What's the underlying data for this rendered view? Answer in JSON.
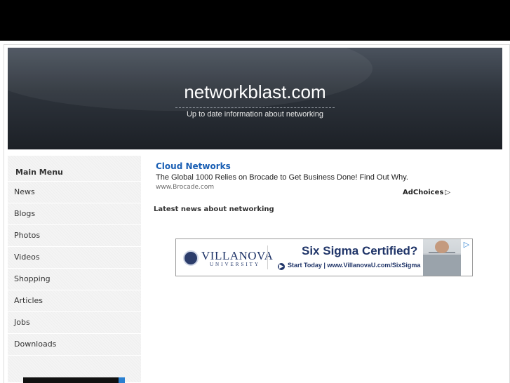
{
  "header": {
    "site_title": "networkblast.com",
    "tagline": "Up to date information about networking"
  },
  "sidebar": {
    "title": "Main Menu",
    "items": [
      {
        "label": "News"
      },
      {
        "label": "Blogs"
      },
      {
        "label": "Photos"
      },
      {
        "label": "Videos"
      },
      {
        "label": "Shopping"
      },
      {
        "label": "Articles"
      },
      {
        "label": "Jobs"
      },
      {
        "label": "Downloads"
      }
    ]
  },
  "text_ad": {
    "title": "Cloud Networks",
    "text": "The Global 1000 Relies on Brocade to Get Business Done! Find Out Why.",
    "url": "www.Brocade.com",
    "adchoices": "AdChoices"
  },
  "main": {
    "section_title": "Latest news about networking"
  },
  "banner_ad": {
    "brand": "VILLANOVA",
    "brand_sub": "UNIVERSITY",
    "headline": "Six Sigma Certified?",
    "cta": "Start Today | www.VillanovaU.com/SixSigma"
  },
  "colors": {
    "top_bar": "#000000",
    "header_bg": "#2d333b",
    "ad_link": "#1a5fb4",
    "banner_navy": "#1f3468"
  },
  "icons": {
    "adchoices": "adchoices-triangle-icon",
    "banner_ad_marker": "ad-marker-icon",
    "cta": "arrow-circle-icon"
  }
}
